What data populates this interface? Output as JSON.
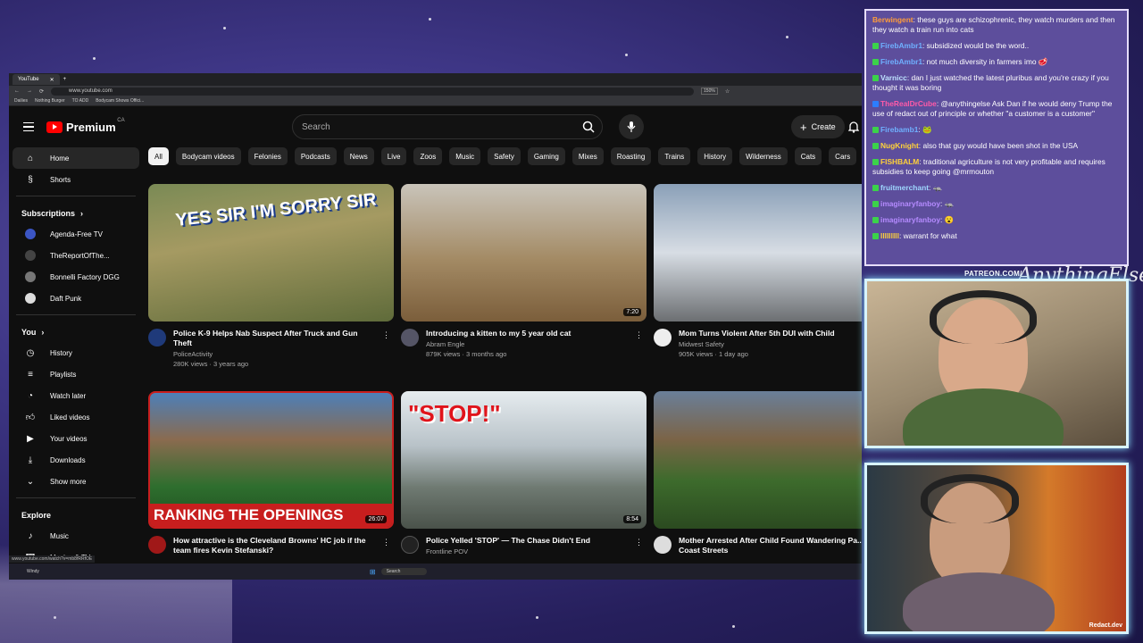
{
  "browser": {
    "tab_title": "YouTube",
    "url": "www.youtube.com",
    "zoom": "150%",
    "bookmarks": [
      "Dailies",
      "Nothing Burger",
      "TO ADD",
      "Bodycam Shows Offici..."
    ]
  },
  "header": {
    "logo_text": "Premium",
    "region": "CA",
    "search_placeholder": "Search",
    "create_label": "Create"
  },
  "sidebar": {
    "top": [
      {
        "label": "Home",
        "icon": "home-icon"
      },
      {
        "label": "Shorts",
        "icon": "shorts-icon"
      }
    ],
    "subscriptions_heading": "Subscriptions",
    "subscriptions": [
      {
        "label": "Agenda-Free TV",
        "color": "#3b55c4"
      },
      {
        "label": "TheReportOfThe...",
        "color": "#444444"
      },
      {
        "label": "Bonnelli Factory DGG",
        "color": "#777777"
      },
      {
        "label": "Daft Punk",
        "color": "#dddddd"
      }
    ],
    "you_heading": "You",
    "you_items": [
      {
        "label": "History",
        "icon": "history-icon"
      },
      {
        "label": "Playlists",
        "icon": "playlists-icon"
      },
      {
        "label": "Watch later",
        "icon": "watch-later-icon"
      },
      {
        "label": "Liked videos",
        "icon": "like-icon"
      },
      {
        "label": "Your videos",
        "icon": "your-videos-icon"
      },
      {
        "label": "Downloads",
        "icon": "download-icon"
      },
      {
        "label": "Show more",
        "icon": "chevron-down-icon"
      }
    ],
    "explore_heading": "Explore",
    "explore_items": [
      {
        "label": "Music",
        "icon": "music-icon"
      },
      {
        "label": "Movies & TV",
        "icon": "movies-icon"
      }
    ]
  },
  "chips": [
    "All",
    "Bodycam videos",
    "Felonies",
    "Podcasts",
    "News",
    "Live",
    "Zoos",
    "Music",
    "Safety",
    "Gaming",
    "Mixes",
    "Roasting",
    "Trains",
    "History",
    "Wilderness",
    "Cats",
    "Cars"
  ],
  "videos": [
    {
      "title": "Police K-9 Helps Nab Suspect After Truck and Gun Theft",
      "channel": "PoliceActivity",
      "stats": "280K views · 3 years ago",
      "duration": "",
      "thumb_text": "YES SIR I'M SORRY SIR"
    },
    {
      "title": "Introducing a kitten to my 5 year old cat",
      "channel": "Abram Engle",
      "stats": "879K views · 3 months ago",
      "duration": "7:20",
      "thumb_text": ""
    },
    {
      "title": "Mom Turns Violent After 5th DUI with Child",
      "channel": "Midwest Safety",
      "stats": "905K views · 1 day ago",
      "duration": "",
      "thumb_text": ""
    },
    {
      "title": "How attractive is the Cleveland Browns' HC job if the team fires Kevin Stefanski?",
      "channel": "",
      "stats": "",
      "duration": "26:07",
      "thumb_text": "RANKING THE OPENINGS"
    },
    {
      "title": "Police Yelled 'STOP' — The Chase Didn't End",
      "channel": "Frontline POV",
      "stats": "",
      "duration": "8:54",
      "thumb_text": "\"STOP!\""
    },
    {
      "title": "Mother Arrested After Child Found Wandering Pa... Coast Streets",
      "channel": "",
      "stats": "",
      "duration": "",
      "thumb_text": ""
    }
  ],
  "status_url": "www.youtube.com/watch?v=mb8fRRfOE",
  "taskbar": {
    "weather": "Windy",
    "search": "Search"
  },
  "chat": [
    {
      "user": "Berwingent",
      "color": "#ff9c3a",
      "text": "these guys are schizophrenic, they watch murders and then they watch a train run into cats"
    },
    {
      "user": "FirebAmbr1",
      "color": "#6fb0ff",
      "text": "subsidized would be the word.."
    },
    {
      "user": "FirebAmbr1",
      "color": "#6fb0ff",
      "text": "not much diversity in farmers imo 🥩"
    },
    {
      "user": "Varnicc",
      "color": "#bfe3ff",
      "text": "dan I just watched the latest pluribus and you're crazy if you thought it was boring"
    },
    {
      "user": "TheRealDrCube",
      "color": "#ff5aa8",
      "text": "@anythingelse Ask Dan if he would deny Trump the use of redact out of principle or whether \"a customer is a customer\""
    },
    {
      "user": "Firebamb1",
      "color": "#6fb0ff",
      "text": "🐸"
    },
    {
      "user": "NugKnight",
      "color": "#ffd23a",
      "text": "also that guy would have been shot in the USA"
    },
    {
      "user": "FISHBALM",
      "color": "#ffd23a",
      "text": "traditional agriculture is not very profitable and requires subsidies to keep going @mrmouton"
    },
    {
      "user": "fruitmerchant",
      "color": "#9fd8ff",
      "text": "🦡"
    },
    {
      "user": "imaginaryfanboy",
      "color": "#b58bff",
      "text": "🦡"
    },
    {
      "user": "imaginaryfanboy",
      "color": "#b58bff",
      "text": "😮"
    },
    {
      "user": "lllllllll",
      "color": "#ffd23a",
      "text": "warrant for what"
    }
  ],
  "overlay": {
    "patreon": "PATREON.COM/",
    "signature": "AnythingElse",
    "watermark": "Redact.dev"
  }
}
